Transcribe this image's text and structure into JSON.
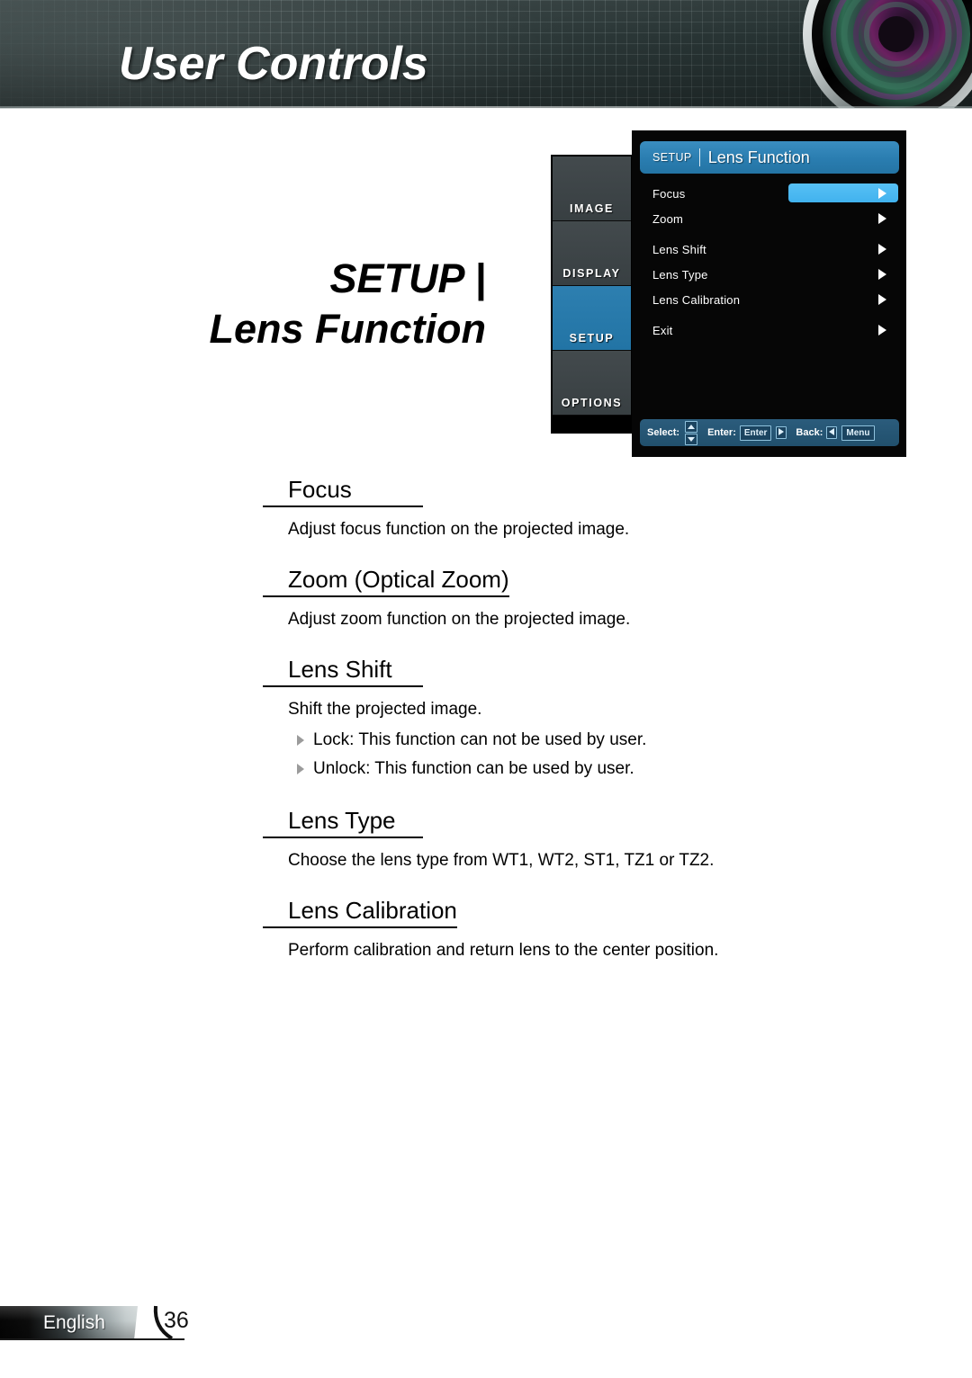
{
  "header": {
    "title": "User Controls",
    "lens_icon": "projector-lens-graphic"
  },
  "page_title": {
    "line1": "SETUP |",
    "line2": "Lens Function"
  },
  "osd": {
    "sidebar_tabs": [
      {
        "label": "IMAGE",
        "selected": false
      },
      {
        "label": "DISPLAY",
        "selected": false
      },
      {
        "label": "SETUP",
        "selected": true
      },
      {
        "label": "OPTIONS",
        "selected": false
      }
    ],
    "title_kicker": "SETUP",
    "title_main": "Lens Function",
    "rows": [
      {
        "label": "Focus",
        "highlighted": true
      },
      {
        "label": "Zoom",
        "highlighted": false
      },
      {
        "label": "Lens Shift",
        "highlighted": false
      },
      {
        "label": "Lens Type",
        "highlighted": false
      },
      {
        "label": "Lens Calibration",
        "highlighted": false
      },
      {
        "label": "Exit",
        "highlighted": false
      }
    ],
    "bottom_bar": {
      "select_label": "Select:",
      "enter_label": "Enter:",
      "enter_key": "Enter",
      "back_label": "Back:",
      "menu_key": "Menu"
    },
    "colors": {
      "title_bar": "#2a7db0",
      "highlight": "#4cb8f0",
      "tab_selected": "#2474a4",
      "bottom_bar": "#24506b",
      "panel_bg": "#060606"
    }
  },
  "sections": [
    {
      "heading": "Focus",
      "body": "Adjust focus function on the projected image.",
      "bullets": []
    },
    {
      "heading": "Zoom (Optical Zoom)",
      "body": "Adjust zoom function on the projected image.",
      "bullets": []
    },
    {
      "heading": "Lens Shift",
      "body": "Shift the projected image.",
      "bullets": [
        "Lock: This function can not be used by user.",
        "Unlock: This function can be used by user."
      ]
    },
    {
      "heading": "Lens Type",
      "body": "Choose the lens type from WT1, WT2, ST1, TZ1 or TZ2.",
      "bullets": []
    },
    {
      "heading": "Lens Calibration",
      "body": "Perform calibration and return lens to the center position.",
      "bullets": []
    }
  ],
  "footer": {
    "language": "English",
    "page_number": "36"
  }
}
